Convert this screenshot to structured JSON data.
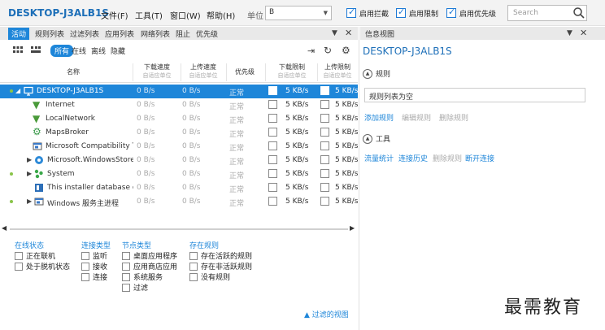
{
  "app_title": "DESKTOP-J3ALB1S",
  "menu": [
    "文件(F)",
    "工具(T)",
    "窗口(W)",
    "帮助(H)"
  ],
  "unit_label": "单位",
  "unit_value": "B",
  "toggles": [
    {
      "label": "启用拦截",
      "checked": true
    },
    {
      "label": "启用限制",
      "checked": true
    },
    {
      "label": "启用优先级",
      "checked": true
    }
  ],
  "search_placeholder": "Search",
  "tabs": [
    "活动",
    "规则列表",
    "过滤列表",
    "应用列表",
    "网络列表",
    "阻止",
    "优先级"
  ],
  "filters": {
    "all": "所有",
    "online": "在线",
    "offline": "离线",
    "hidden": "隐藏"
  },
  "columns": {
    "name": "名称",
    "down": "下载速度",
    "down_sub": "自适应单位",
    "up": "上传速度",
    "up_sub": "自适应单位",
    "prio": "优先级",
    "down_limit": "下载限制",
    "down_limit_sub": "自适应单位",
    "up_limit": "上传限制",
    "up_limit_sub": "自适应单位"
  },
  "rows": [
    {
      "name": "DESKTOP-J3ALB1S",
      "down": "0 B/s",
      "up": "0 B/s",
      "prio": "正常",
      "dl": "5 KB/s",
      "ul": "5 KB/s"
    },
    {
      "name": "Internet",
      "down": "0 B/s",
      "up": "0 B/s",
      "prio": "正常",
      "dl": "5 KB/s",
      "ul": "5 KB/s"
    },
    {
      "name": "LocalNetwork",
      "down": "0 B/s",
      "up": "0 B/s",
      "prio": "正常",
      "dl": "5 KB/s",
      "ul": "5 KB/s"
    },
    {
      "name": "MapsBroker",
      "down": "0 B/s",
      "up": "0 B/s",
      "prio": "正常",
      "dl": "5 KB/s",
      "ul": "5 KB/s"
    },
    {
      "name": "Microsoft Compatibility T",
      "down": "0 B/s",
      "up": "0 B/s",
      "prio": "正常",
      "dl": "5 KB/s",
      "ul": "5 KB/s"
    },
    {
      "name": "Microsoft.WindowsStore_",
      "down": "0 B/s",
      "up": "0 B/s",
      "prio": "正常",
      "dl": "5 KB/s",
      "ul": "5 KB/s"
    },
    {
      "name": "System",
      "down": "0 B/s",
      "up": "0 B/s",
      "prio": "正常",
      "dl": "5 KB/s",
      "ul": "5 KB/s"
    },
    {
      "name": "This installer database co",
      "down": "0 B/s",
      "up": "0 B/s",
      "prio": "正常",
      "dl": "5 KB/s",
      "ul": "5 KB/s"
    },
    {
      "name": "Windows 服务主进程",
      "down": "0 B/s",
      "up": "0 B/s",
      "prio": "正常",
      "dl": "5 KB/s",
      "ul": "5 KB/s"
    }
  ],
  "filter_groups": {
    "online_status": {
      "title": "在线状态",
      "items": [
        "正在联机",
        "处于脱机状态"
      ]
    },
    "conn_type": {
      "title": "连接类型",
      "items": [
        "监听",
        "接收",
        "连接"
      ]
    },
    "node_type": {
      "title": "节点类型",
      "items": [
        "桌面应用程序",
        "应用商店应用",
        "系统服务",
        "过滤"
      ]
    },
    "has_rules": {
      "title": "存在规则",
      "items": [
        "存在活跃的规则",
        "存在非活跃规则",
        "没有规则"
      ]
    }
  },
  "filtered_view": "过滤的视图",
  "info": {
    "title": "信息视图",
    "host": "DESKTOP-J3ALB1S",
    "rules_section": "规则",
    "rules_empty": "规则列表为空",
    "rule_actions": [
      "添加规则",
      "编辑规则",
      "删除规则"
    ],
    "tools_section": "工具",
    "tool_actions": [
      "流量统计",
      "连接历史",
      "删除规则",
      "断开连接"
    ]
  },
  "watermark": "最需教育"
}
